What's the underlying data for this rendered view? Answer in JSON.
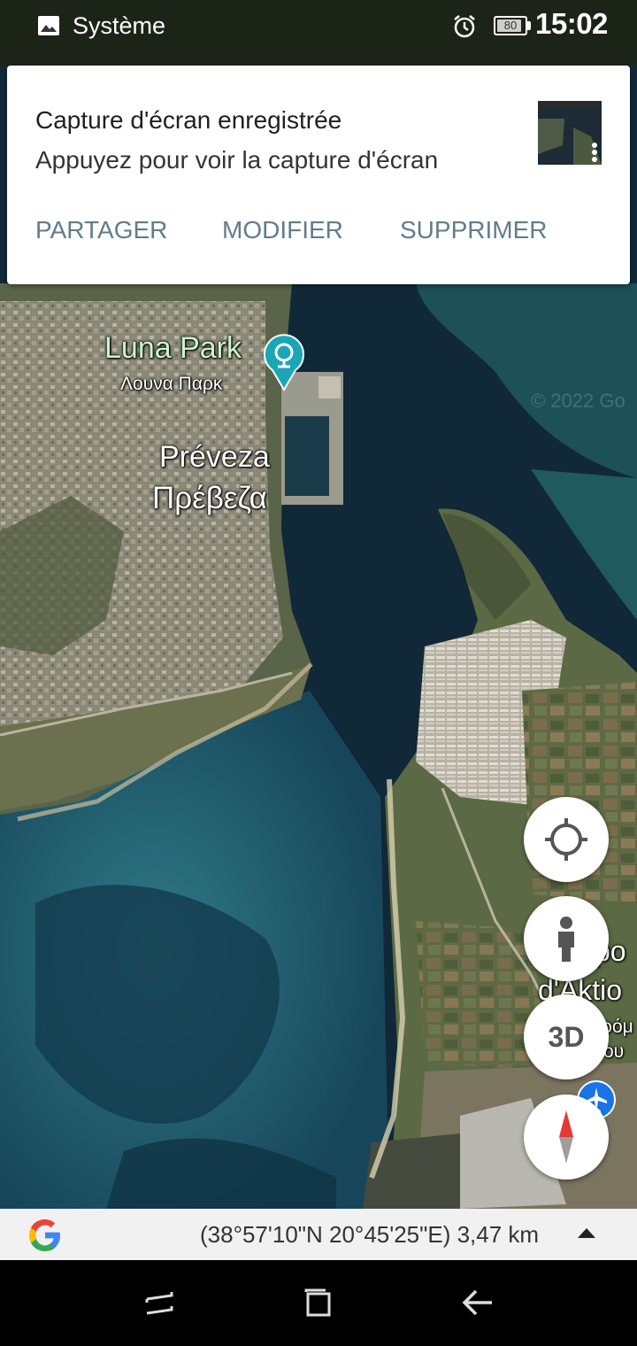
{
  "status_bar": {
    "notification_source": "Système",
    "battery_level": "80",
    "time": "15:02",
    "icons": [
      "image-icon",
      "alarm-icon",
      "battery-icon"
    ]
  },
  "notification": {
    "title": "Capture d'écran enregistrée",
    "text": "Appuyez pour voir la capture d'écran",
    "actions": {
      "share": "PARTAGER",
      "edit": "MODIFIER",
      "delete": "SUPPRIMER"
    },
    "action_color": "#607d8b"
  },
  "map": {
    "labels": {
      "luna_park": "Luna Park",
      "luna_park_greek": "Λουνα Παρκ",
      "city": "Préveza",
      "city_greek": "Πρέβεζα",
      "aktio_line1": "po",
      "aktio_line2": "d'Aktio",
      "aktio_line3": "ρόμ",
      "aktio_line4": "ου"
    },
    "copyright": "© 2022 Go",
    "poi_icon": "amusement-park-icon",
    "airport_icon": "airport-icon"
  },
  "controls": {
    "three_d_label": "3D",
    "icons": [
      "my-location-icon",
      "street-view-icon",
      "compass-icon"
    ]
  },
  "info_bar": {
    "coordinates": "(38°57'10\"N 20°45'25\"E) 3,47 km",
    "logo": "google-logo"
  },
  "nav_bar": {
    "icons": [
      "recents-icon",
      "home-icon",
      "back-icon"
    ]
  }
}
